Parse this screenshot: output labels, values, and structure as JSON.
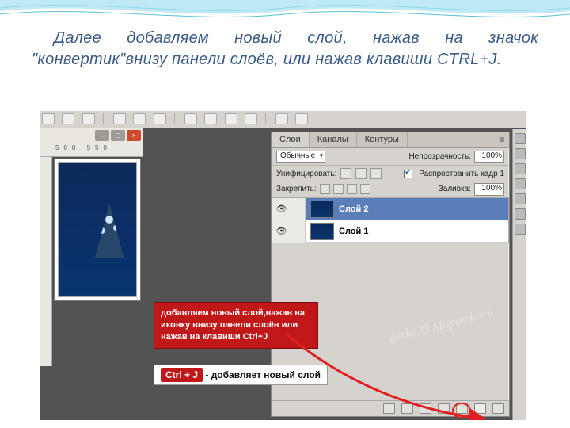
{
  "caption": "Далее добавляем новый слой, нажав на значок \"конвертик\"внизу панели слоёв, или нажав клавиши CTRL+J.",
  "ruler": {
    "marks": "500        550"
  },
  "docwin": {
    "min": "–",
    "max": "□",
    "close": "×"
  },
  "panel": {
    "tabs": {
      "layers": "Слои",
      "channels": "Каналы",
      "paths": "Контуры"
    },
    "mode": "Обычные",
    "opacity_label": "Непрозрачность:",
    "opacity_value": "100%",
    "unify_label": "Унифицировать:",
    "propagate_label": "Распространить кадр 1",
    "lock_label": "Закрепить:",
    "fill_label": "Заливка:",
    "fill_value": "100%",
    "layers": [
      {
        "name": "Слой 2",
        "selected": true
      },
      {
        "name": "Слой 1",
        "selected": false
      }
    ]
  },
  "callout1": "добавляем новый слой,нажав на иконку внизу панели слоёв или нажав на клавиши Ctrl+J",
  "callout2": {
    "kbd": "Ctrl + J",
    "rest": "- добавляет новый слой"
  },
  "watermark": "gerka.O.Mopomkova"
}
